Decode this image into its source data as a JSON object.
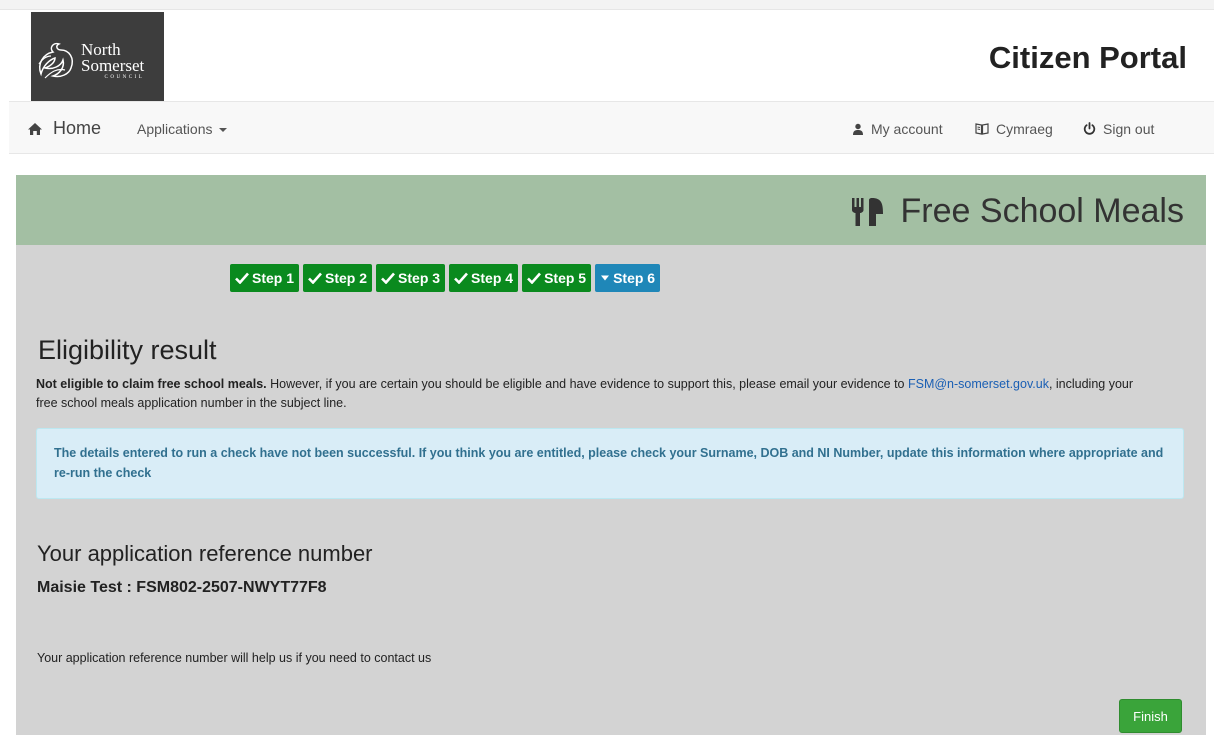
{
  "header": {
    "logo": {
      "line1": "North",
      "line2": "Somerset",
      "line3": "COUNCIL"
    },
    "portal_title": "Citizen Portal"
  },
  "nav": {
    "home": "Home",
    "applications": "Applications",
    "my_account": "My account",
    "cymraeg": "Cymraeg",
    "sign_out": "Sign out"
  },
  "panel": {
    "title": "Free School Meals",
    "steps": [
      {
        "label": "Step 1",
        "state": "done"
      },
      {
        "label": "Step 2",
        "state": "done"
      },
      {
        "label": "Step 3",
        "state": "done"
      },
      {
        "label": "Step 4",
        "state": "done"
      },
      {
        "label": "Step 5",
        "state": "done"
      },
      {
        "label": "Step 6",
        "state": "current"
      }
    ],
    "eligibility": {
      "heading": "Eligibility result",
      "bold_text": "Not eligible to claim free school meals.",
      "text_before_link": " However, if you are certain you should be eligible and have evidence to support this, please email your evidence to ",
      "email_link": "FSM@n-somerset.gov.uk",
      "text_after_link": ", including your free school meals application number in the subject line."
    },
    "info_message": "The details entered to run a check have not been successful. If you think you are entitled, please check your Surname, DOB and NI Number, update this information where appropriate and re-run the check",
    "reference": {
      "heading": "Your application reference number",
      "value": "Maisie Test : FSM802-2507-NWYT77F8",
      "help": "Your application reference number will help us if you need to contact us"
    },
    "finish_button": "Finish"
  },
  "colors": {
    "panel_bg": "#d3d3d3",
    "header_band": "#a3bfa3",
    "step_done": "#0a8a1e",
    "step_current": "#1f87b8",
    "info_bg": "#d9edf7",
    "info_text": "#31708f",
    "finish_button": "#3aa43a"
  },
  "icons": {
    "home": "home-icon",
    "account": "user-icon",
    "cymraeg": "book-icon",
    "sign_out": "power-icon",
    "meals": "cutlery-icon",
    "step_done": "check-icon",
    "step_current": "caret-down-icon"
  }
}
